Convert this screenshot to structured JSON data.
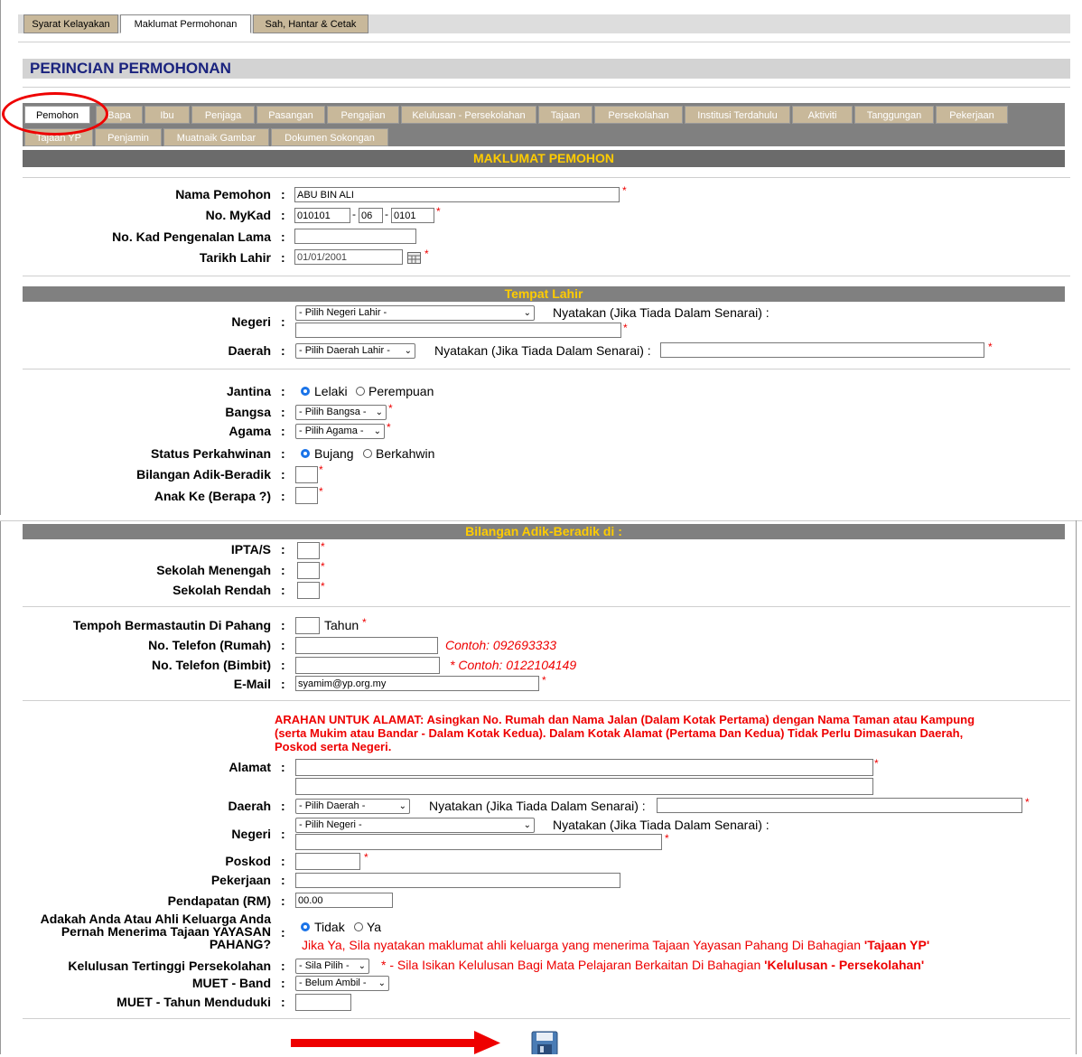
{
  "top_tabs": [
    "Syarat Kelayakan",
    "Maklumat Permohonan",
    "Sah, Hantar & Cetak"
  ],
  "page_title": "PERINCIAN PERMOHONAN",
  "sub_tabs_row1": [
    "Pemohon",
    "Bapa",
    "Ibu",
    "Penjaga",
    "Pasangan",
    "Pengajian",
    "Kelulusan - Persekolahan",
    "Tajaan",
    "Persekolahan",
    "Institusi Terdahulu",
    "Aktiviti",
    "Tanggungan",
    "Pekerjaan"
  ],
  "sub_tabs_row2": [
    "Tajaan YP",
    "Penjamin",
    "Muatnaik Gambar",
    "Dokumen Sokongan"
  ],
  "section_main": "MAKLUMAT PEMOHON",
  "labels": {
    "nama": "Nama Pemohon",
    "mykad": "No. MyKad",
    "kp_lama": "No. Kad Pengenalan Lama",
    "tarikh_lahir": "Tarikh Lahir",
    "negeri": "Negeri",
    "daerah": "Daerah",
    "jantina": "Jantina",
    "bangsa": "Bangsa",
    "agama": "Agama",
    "status": "Status Perkahwinan",
    "bil_adik": "Bilangan Adik-Beradik",
    "anak_ke": "Anak Ke (Berapa ?)",
    "ipta": "IPTA/S",
    "sek_menengah": "Sekolah Menengah",
    "sek_rendah": "Sekolah Rendah",
    "tempoh": "Tempoh Bermastautin Di Pahang",
    "tel_rumah": "No. Telefon (Rumah)",
    "tel_bimbit": "No. Telefon (Bimbit)",
    "email": "E-Mail",
    "alamat": "Alamat",
    "daerah2": "Daerah",
    "negeri2": "Negeri",
    "poskod": "Poskod",
    "pekerjaan": "Pekerjaan",
    "pendapatan": "Pendapatan (RM)",
    "tajaan_q1": "Adakah Anda Atau Ahli Keluarga Anda",
    "tajaan_q2": "Pernah Menerima Tajaan YAYASAN",
    "tajaan_q3": "PAHANG?",
    "kelulusan": "Kelulusan Tertinggi Persekolahan",
    "muet_band": "MUET - Band",
    "muet_tahun": "MUET - Tahun Menduduki"
  },
  "values": {
    "nama": "ABU BIN ALI",
    "mykad1": "010101",
    "mykad2": "06",
    "mykad3": "0101",
    "tarikh_lahir": "01/01/2001",
    "email": "syamim@yp.org.my",
    "pendapatan": "00.00"
  },
  "selects": {
    "negeri_lahir": "- Pilih Negeri Lahir -",
    "daerah_lahir": "- Pilih Daerah Lahir -",
    "bangsa": "- Pilih Bangsa -",
    "agama": "- Pilih Agama -",
    "daerah": "- Pilih Daerah -",
    "negeri": "- Pilih Negeri -",
    "kelulusan": "- Sila Pilih -",
    "muet_band": "- Belum Ambil -"
  },
  "texts": {
    "tempat_lahir": "Tempat Lahir",
    "nyatakan": "Nyatakan (Jika Tiada Dalam Senarai) :",
    "lelaki": "Lelaki",
    "perempuan": "Perempuan",
    "bujang": "Bujang",
    "berkahwin": "Berkahwin",
    "bil_adik_di": "Bilangan Adik-Beradik di :",
    "tahun": "Tahun",
    "contoh_rumah": "Contoh: 092693333",
    "contoh_bimbit": "* Contoh: 0122104149",
    "arahan1": "ARAHAN UNTUK ALAMAT: Asingkan No. Rumah dan Nama Jalan (Dalam Kotak Pertama) dengan Nama Taman atau Kampung",
    "arahan2": "(serta Mukim atau Bandar - Dalam Kotak Kedua). Dalam Kotak Alamat (Pertama Dan Kedua) Tidak Perlu Dimasukan Daerah,",
    "arahan3": "Poskod serta Negeri.",
    "tidak": "Tidak",
    "ya": "Ya",
    "tajaan_note_a": "Jika Ya, Sila nyatakan maklumat ahli keluarga yang menerima Tajaan Yayasan Pahang Di Bahagian ",
    "tajaan_note_b": "'Tajaan YP'",
    "kel_note_a": "* - Sila Isikan Kelulusan Bagi Mata Pelajaran Berkaitan Di Bahagian ",
    "kel_note_b": "'Kelulusan - Persekolahan'"
  },
  "colors": {
    "tab_bg": "#c8b89a",
    "section_bar": "#808080",
    "section_text": "#ffcc00",
    "required": "#e00000",
    "annotation": "#e00000"
  }
}
